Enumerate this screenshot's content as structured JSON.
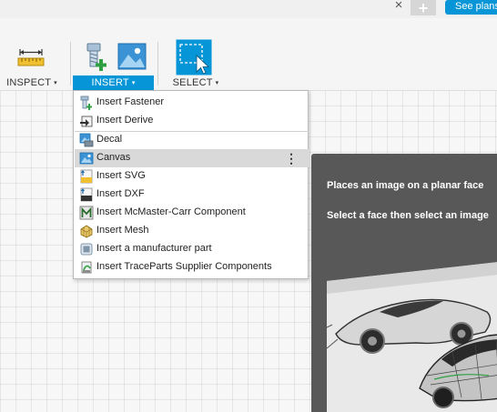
{
  "tabs": {
    "close_glyph": "×",
    "new_glyph": "+",
    "see_plans_label": "See plans"
  },
  "toolbar": {
    "inspect": {
      "label": "INSPECT",
      "caret": "▾",
      "icon": "ruler-icon"
    },
    "insert": {
      "label": "INSERT",
      "caret": "▾",
      "icons": [
        "insert-fastener-icon",
        "insert-image-icon"
      ]
    },
    "select": {
      "label": "SELECT",
      "caret": "▾",
      "icon": "select-cursor-icon"
    }
  },
  "insert_menu": {
    "items": [
      {
        "label": "Insert Fastener",
        "icon": "fastener-icon"
      },
      {
        "label": "Insert Derive",
        "icon": "derive-icon"
      },
      {
        "label": "Decal",
        "icon": "decal-icon"
      },
      {
        "label": "Canvas",
        "icon": "canvas-icon",
        "highlighted": true,
        "more_glyph": "⋮"
      },
      {
        "label": "Insert SVG",
        "icon": "svg-file-icon"
      },
      {
        "label": "Insert DXF",
        "icon": "dxf-file-icon"
      },
      {
        "label": "Insert McMaster-Carr Component",
        "icon": "mcmaster-icon"
      },
      {
        "label": "Insert Mesh",
        "icon": "mesh-icon"
      },
      {
        "label": "Insert a manufacturer part",
        "icon": "manufacturer-part-icon"
      },
      {
        "label": "Insert TraceParts Supplier Components",
        "icon": "traceparts-icon"
      }
    ]
  },
  "tooltip": {
    "line1": "Places an image on a planar face",
    "line2": "Select a face then select an image"
  },
  "colors": {
    "accent": "#0696d7",
    "tooltip_bg": "#585858",
    "menu_highlight": "#d9d9d9"
  }
}
